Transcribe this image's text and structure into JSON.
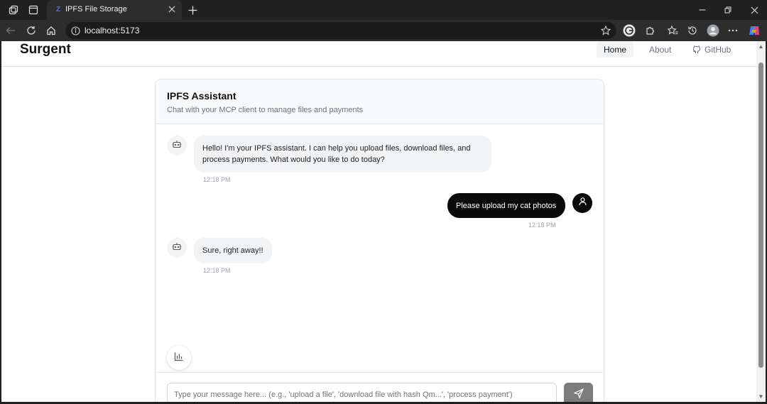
{
  "browser": {
    "tab_title": "IPFS File Storage",
    "tab_favicon": "Z",
    "url": "localhost:5173",
    "icons": [
      "workspaces-icon",
      "tab-actions-icon",
      "close-tab-icon",
      "new-tab-icon",
      "minimize-icon",
      "restore-icon",
      "close-window-icon",
      "back-icon",
      "refresh-icon",
      "home-icon",
      "site-info-icon",
      "favorite-star-icon",
      "grammarly-icon",
      "extensions-icon",
      "favorites-icon",
      "history-icon",
      "profile-icon",
      "more-icon",
      "copilot-icon"
    ]
  },
  "header": {
    "brand": "Surgent",
    "nav": [
      {
        "label": "Home",
        "active": true
      },
      {
        "label": "About",
        "active": false
      },
      {
        "label": "GitHub",
        "active": false,
        "icon": "github-icon"
      }
    ]
  },
  "chat": {
    "title": "IPFS Assistant",
    "subtitle": "Chat with your MCP client to manage files and payments",
    "messages": [
      {
        "role": "bot",
        "text": "Hello! I'm your IPFS assistant. I can help you upload files, download files, and process payments. What would you like to do today?",
        "time": "12:18 PM",
        "icon": "bot-icon"
      },
      {
        "role": "user",
        "text": "Please upload my cat photos",
        "time": "12:18 PM",
        "icon": "user-icon"
      },
      {
        "role": "bot",
        "text": "Sure, right away!!",
        "time": "12:18 PM",
        "icon": "bot-icon"
      }
    ],
    "stats_icon": "bar-chart-icon",
    "input_placeholder": "Type your message here... (e.g., 'upload a file', 'download file with hash Qm...', 'process payment')",
    "input_value": "",
    "send_icon": "send-icon"
  },
  "colors": {
    "accent_dark": "#0a0a0a",
    "bot_bubble": "#f3f4f6",
    "send_button": "#7c7c7c"
  }
}
